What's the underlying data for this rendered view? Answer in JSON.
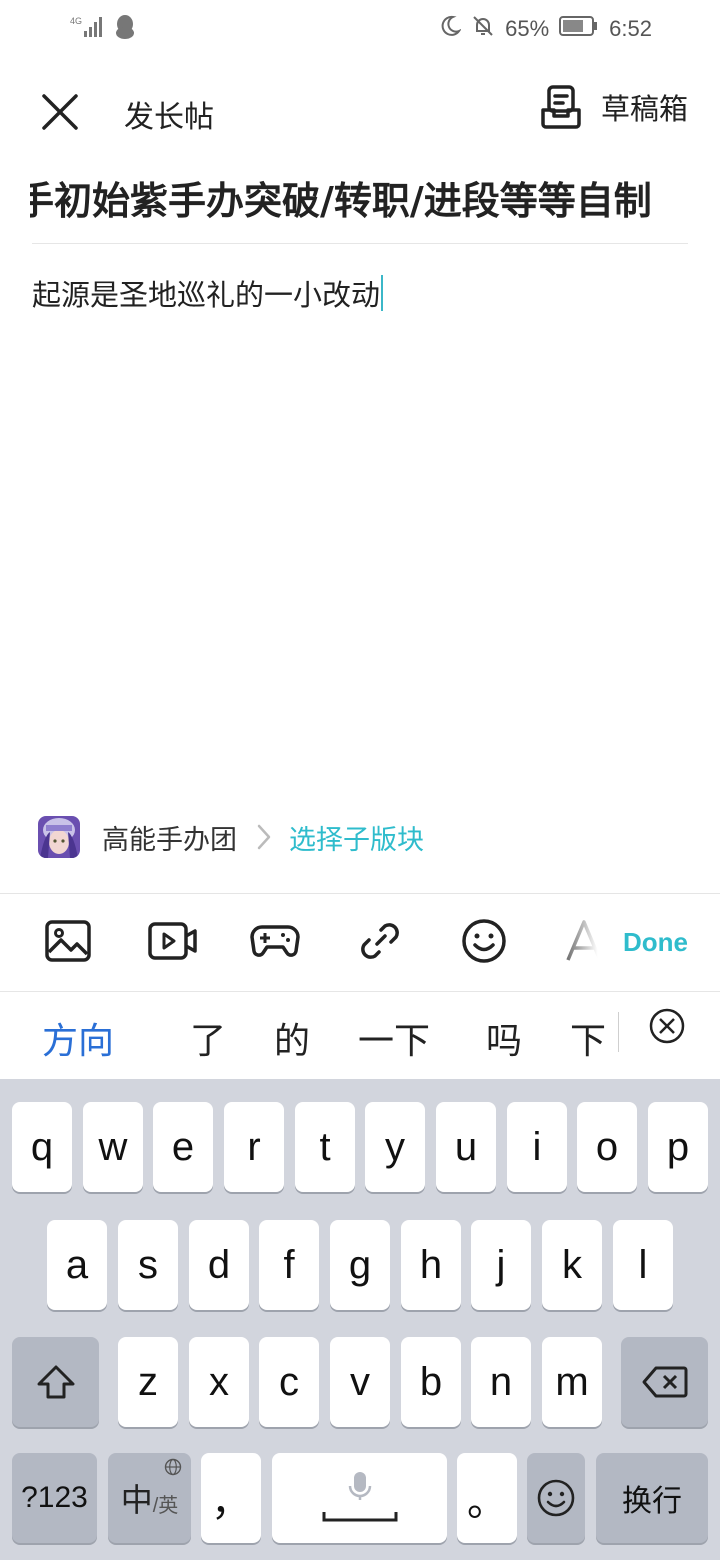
{
  "status_bar": {
    "network": "4G",
    "battery_percent": "65%",
    "time": "6:52",
    "icons": [
      "signal-icon",
      "qq-icon",
      "moon-icon",
      "mute-bell-icon",
      "battery-icon"
    ]
  },
  "header": {
    "title": "发长帖",
    "drafts_label": "草稿箱"
  },
  "post": {
    "title": "手初始紫手办突破/转职/进段等等自制",
    "body": "起源是圣地巡礼的一小改动"
  },
  "forum": {
    "name": "高能手办团",
    "select_subforum": "选择子版块"
  },
  "toolbar": {
    "tools": [
      "image-icon",
      "video-icon",
      "game-icon",
      "link-icon",
      "emoji-icon",
      "font-icon"
    ],
    "done_label": "Done",
    "accent": "#2fbccc"
  },
  "candidates": {
    "items": [
      "方向",
      "了",
      "的",
      "一下",
      "吗",
      "下"
    ],
    "active_color": "#2a6fd6"
  },
  "keyboard": {
    "row1": [
      "q",
      "w",
      "e",
      "r",
      "t",
      "y",
      "u",
      "i",
      "o",
      "p"
    ],
    "row2": [
      "a",
      "s",
      "d",
      "f",
      "g",
      "h",
      "j",
      "k",
      "l"
    ],
    "row3": [
      "z",
      "x",
      "c",
      "v",
      "b",
      "n",
      "m"
    ],
    "numbers_key": "?123",
    "lang_key_main": "中",
    "lang_key_sub": "/英",
    "comma_key": "，",
    "period_key": "。",
    "enter_key": "换行"
  }
}
